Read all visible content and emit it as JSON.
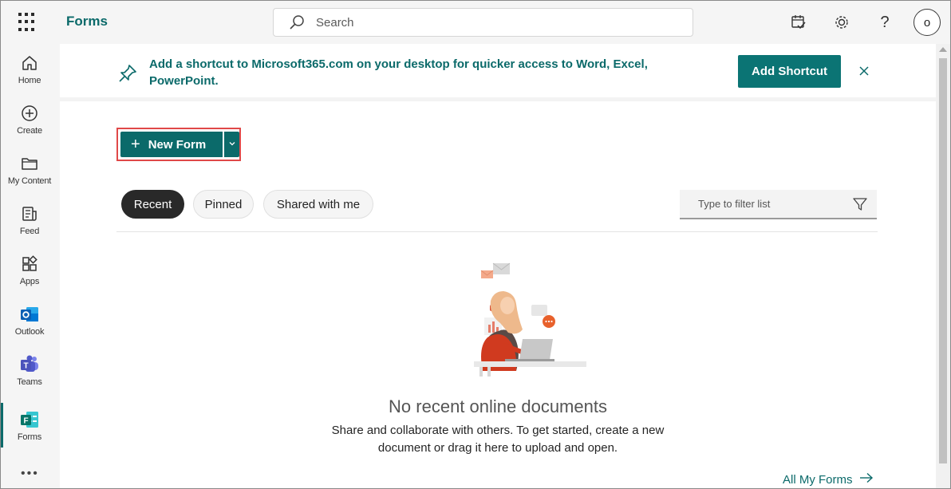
{
  "header": {
    "app_title": "Forms",
    "search_placeholder": "Search",
    "avatar_initial": "o"
  },
  "rail": {
    "items": [
      {
        "label": "Home",
        "icon": "home-icon"
      },
      {
        "label": "Create",
        "icon": "plus-circle-icon"
      },
      {
        "label": "My Content",
        "icon": "folder-icon"
      },
      {
        "label": "Feed",
        "icon": "feed-icon"
      },
      {
        "label": "Apps",
        "icon": "apps-icon"
      },
      {
        "label": "Outlook",
        "icon": "outlook-icon"
      },
      {
        "label": "Teams",
        "icon": "teams-icon"
      },
      {
        "label": "Forms",
        "icon": "forms-icon"
      }
    ],
    "more": "•••"
  },
  "banner": {
    "message": "Add a shortcut to Microsoft365.com on your desktop for quicker access to Word, Excel, PowerPoint.",
    "button": "Add Shortcut"
  },
  "new_form": {
    "label": "New Form"
  },
  "tabs": [
    {
      "label": "Recent",
      "active": true
    },
    {
      "label": "Pinned",
      "active": false
    },
    {
      "label": "Shared with me",
      "active": false
    }
  ],
  "filter": {
    "placeholder": "Type to filter list"
  },
  "empty_state": {
    "title": "No recent online documents",
    "line1": "Share and collaborate with others. To get started, create a new",
    "line2": "document or drag it here to upload and open."
  },
  "footer_link": "All My Forms",
  "colors": {
    "accent": "#0b6a6a",
    "highlight_border": "#e04848"
  }
}
